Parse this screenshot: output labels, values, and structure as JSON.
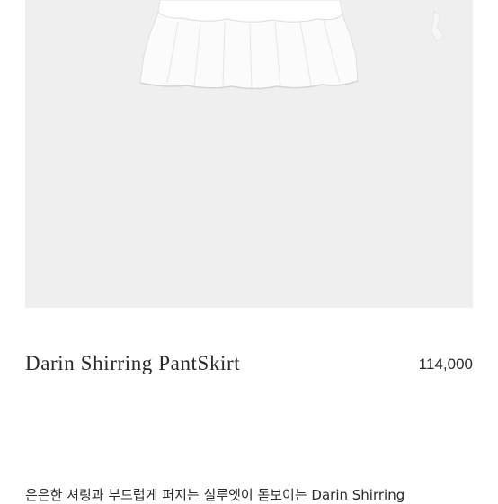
{
  "product": {
    "image_alt": "white shirring pant skirt",
    "name": "Darin Shirring PantSkirt",
    "price": "114,000",
    "description": "은은한 셔링과 부드럽게 퍼지는 실루엣이 돋보이는 Darin Shirring"
  },
  "colors": {
    "image_bg": "#efefef",
    "text": "#2a2a2a"
  }
}
